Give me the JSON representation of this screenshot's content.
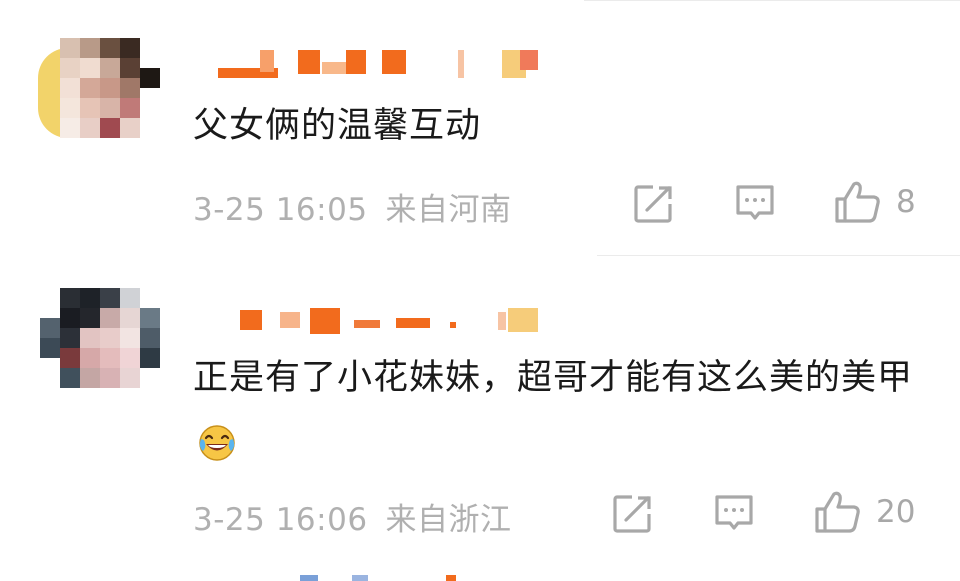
{
  "comments": [
    {
      "text": "父女俩的温馨互动",
      "time": "3-25 16:05",
      "location": "来自河南",
      "likes": "8"
    },
    {
      "text": "正是有了小花妹妹，超哥才能有这么美的美甲",
      "time": "3-25 16:06",
      "location": "来自浙江",
      "likes": "20"
    }
  ],
  "icons": {
    "repost": "repost-icon",
    "comment": "comment-icon",
    "like": "thumbs-up-icon",
    "emoji": "laughing-tears-emoji"
  },
  "colors": {
    "text": "#1a1a1a",
    "meta": "#b0b0b0",
    "icon": "#a8a8a8",
    "divider": "#ebebeb",
    "censor_orange": "#f26b1d"
  }
}
